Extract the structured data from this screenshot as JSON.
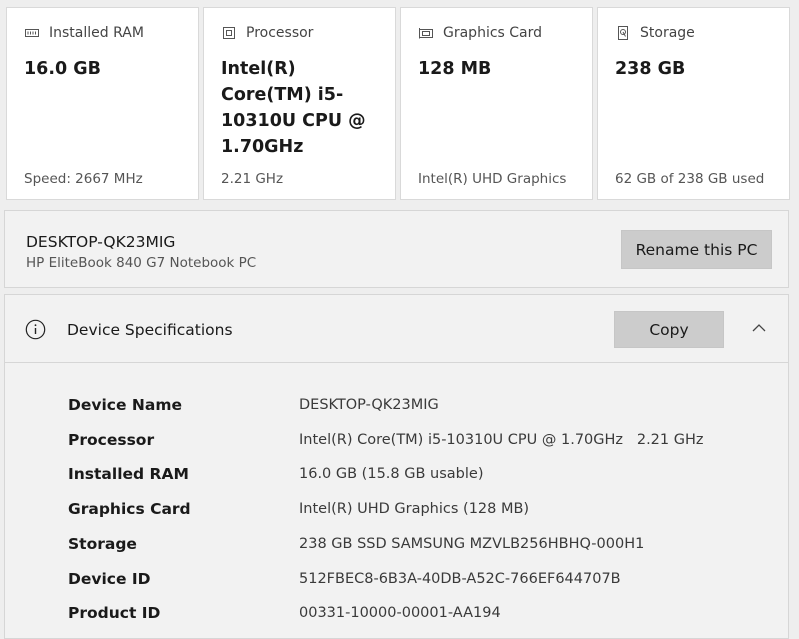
{
  "cards": [
    {
      "title": "Installed RAM",
      "icon": "ram-icon",
      "value": "16.0 GB",
      "footer": "Speed: 2667 MHz"
    },
    {
      "title": "Processor",
      "icon": "processor-icon",
      "value": "Intel(R) Core(TM) i5-10310U CPU @ 1.70GHz",
      "footer": "2.21 GHz"
    },
    {
      "title": "Graphics Card",
      "icon": "graphics-card-icon",
      "value": "128 MB",
      "footer": "Intel(R) UHD Graphics"
    },
    {
      "title": "Storage",
      "icon": "storage-icon",
      "value": "238 GB",
      "footer": "62 GB of 238 GB used"
    }
  ],
  "pc": {
    "name": "DESKTOP-QK23MIG",
    "model": "HP EliteBook 840 G7 Notebook PC",
    "rename_label": "Rename this PC"
  },
  "specs": {
    "title": "Device Specifications",
    "copy_label": "Copy",
    "icons": {
      "info": "info-icon",
      "collapse": "chevron-up-icon"
    },
    "rows": [
      {
        "label": "Device Name",
        "value": "DESKTOP-QK23MIG"
      },
      {
        "label": "Processor",
        "value": "Intel(R) Core(TM) i5-10310U CPU @ 1.70GHz   2.21 GHz"
      },
      {
        "label": "Installed RAM",
        "value": "16.0 GB (15.8 GB usable)"
      },
      {
        "label": "Graphics Card",
        "value": "Intel(R) UHD Graphics (128 MB)"
      },
      {
        "label": "Storage",
        "value": "238 GB SSD SAMSUNG MZVLB256HBHQ-000H1"
      },
      {
        "label": "Device ID",
        "value": "512FBEC8-6B3A-40DB-A52C-766EF644707B"
      },
      {
        "label": "Product ID",
        "value": "00331-10000-00001-AA194"
      }
    ]
  },
  "colors": {
    "page_background": "#eeeeee",
    "card_background": "#ffffff",
    "panel_background": "#f2f2f2",
    "button_background": "#cccccc",
    "border": "#d6d6d6"
  }
}
